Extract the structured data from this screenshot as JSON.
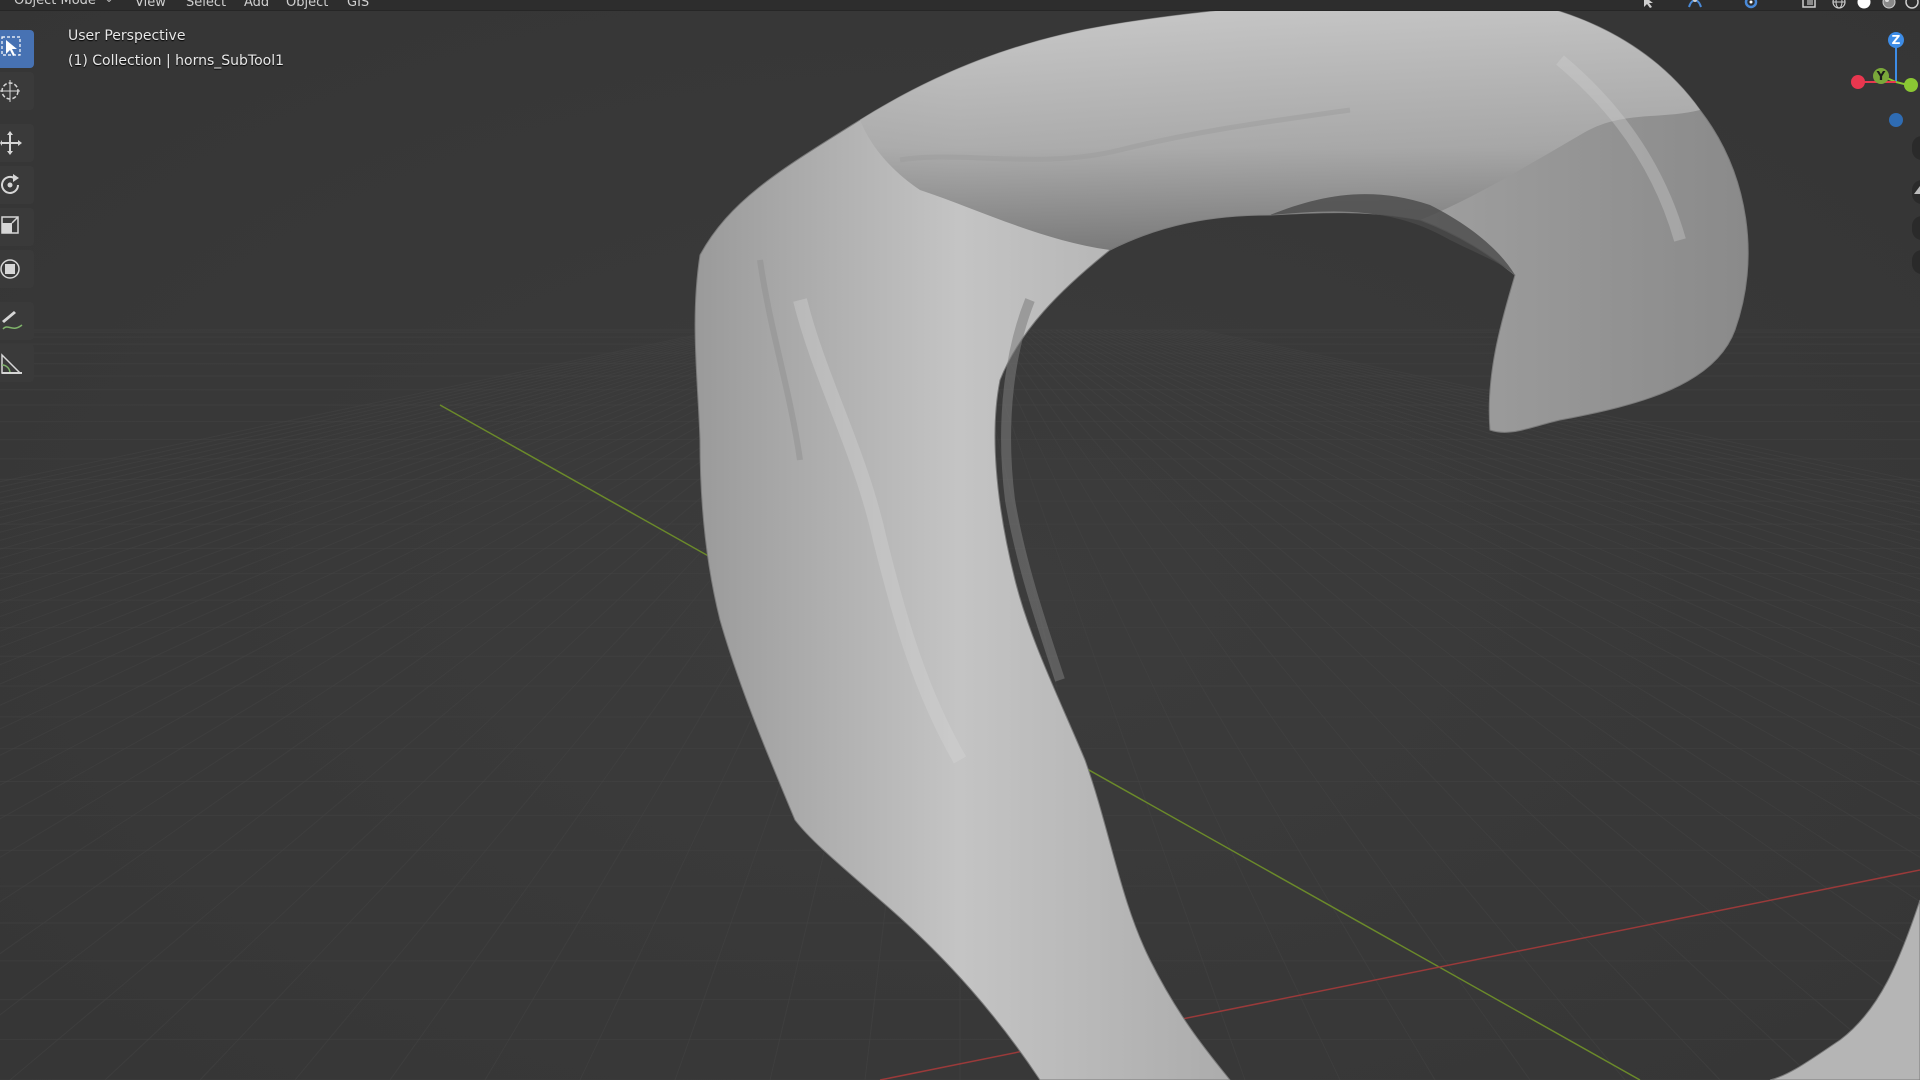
{
  "header": {
    "mode_label": "Object Mode",
    "menu": [
      "View",
      "Select",
      "Add",
      "Object",
      "GIS"
    ]
  },
  "overlay": {
    "view_name": "User Perspective",
    "object_info": "(1) Collection | horns_SubTool1"
  },
  "toolbar": {
    "tools": [
      {
        "name": "select-box",
        "icon": "select-box-icon",
        "active": true
      },
      {
        "name": "cursor",
        "icon": "cursor-icon",
        "active": false
      },
      {
        "name": "move",
        "icon": "move-icon",
        "active": false
      },
      {
        "name": "rotate",
        "icon": "rotate-icon",
        "active": false
      },
      {
        "name": "scale",
        "icon": "scale-icon",
        "active": false
      },
      {
        "name": "transform",
        "icon": "transform-icon",
        "active": false
      },
      {
        "name": "annotate",
        "icon": "annotate-icon",
        "active": false
      },
      {
        "name": "measure",
        "icon": "measure-icon",
        "active": false
      }
    ]
  },
  "gizmo": {
    "z_label": "Z",
    "y_label": "Y",
    "colors": {
      "x": "#e8374f",
      "y": "#8bc833",
      "z": "#3d8ce6"
    }
  },
  "header_icons": [
    "select-tool-icon",
    "transform-pivot-icon",
    "snap-icon",
    "show-gizmo-icon",
    "xray-icon",
    "wireframe-shading-icon",
    "solid-shading-icon",
    "material-shading-icon",
    "rendered-shading-icon"
  ],
  "colors": {
    "background": "#393939",
    "grid": "#444444",
    "x_axis": "#9a3a3a",
    "y_axis": "#6b8a2a",
    "mesh": "#b9b9b9",
    "active_tool": "#4772b3"
  }
}
